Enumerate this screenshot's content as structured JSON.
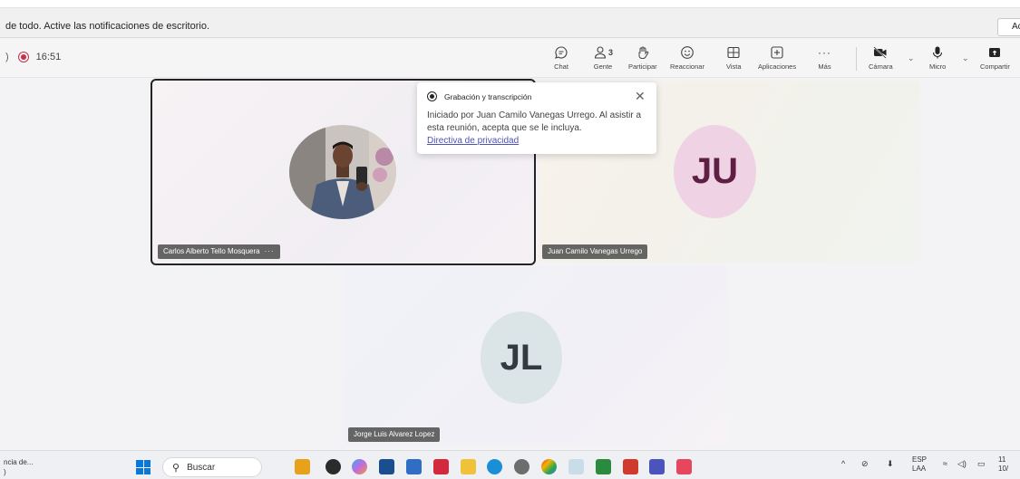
{
  "banner": {
    "text": "de todo. Active las notificaciones de escritorio.",
    "button_label": "Ac"
  },
  "meeting": {
    "paren": ")",
    "time": "16:51"
  },
  "toolbar": {
    "chat": "Chat",
    "people": "Gente",
    "people_count": "3",
    "raise": "Participar",
    "react": "Reaccionar",
    "view": "Vista",
    "apps": "Aplicaciones",
    "more": "Más",
    "camera": "Cámara",
    "mic": "Micro",
    "share": "Compartir"
  },
  "participants": {
    "carlos": {
      "name": "Carlos Alberto Tello Mosquera",
      "more": "···"
    },
    "juan": {
      "name": "Juan Camilo Vanegas Urrego",
      "initials": "JU"
    },
    "jorge": {
      "name": "Jorge Luis Alvarez Lopez",
      "initials": "JL"
    }
  },
  "popup": {
    "title": "Grabación y transcripción",
    "body": "Iniciado por Juan Camilo Vanegas Urrego. Al asistir a esta reunión, acepta que se le incluya.",
    "link": "Directiva de privacidad"
  },
  "taskbar": {
    "left_line1": "ncia de...",
    "left_line2": ")",
    "search_placeholder": "Buscar",
    "lang_line1": "ESP",
    "lang_line2": "LAA",
    "clock_line1": "11",
    "clock_line2": "10/"
  },
  "colors": {
    "record_red": "#c4314b",
    "teams_purple": "#4f52b2",
    "ju_avatar_bg": "#efd3e4",
    "jl_avatar_bg": "#dbe5e8"
  }
}
